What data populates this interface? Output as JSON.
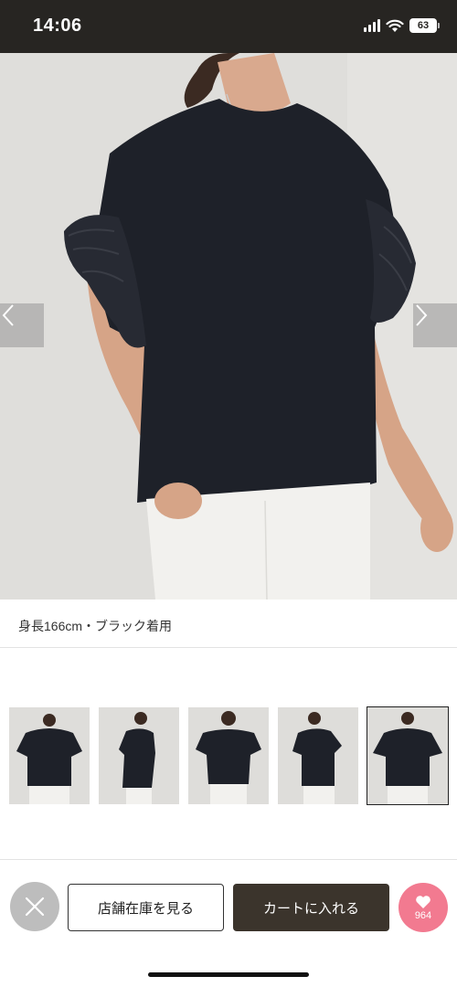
{
  "status_bar": {
    "time": "14:06",
    "battery": "63",
    "icons": [
      "signal-icon",
      "wifi-icon",
      "battery-icon"
    ]
  },
  "product": {
    "image_caption": "身長166cm・ブラック着用",
    "image_alt": "model wearing black ruffle-sleeve t-shirt",
    "thumbnail_count": 5,
    "selected_thumbnail": 5
  },
  "navigation": {
    "prev_icon": "chevron-left-icon",
    "next_icon": "chevron-right-icon"
  },
  "actions": {
    "close_icon": "close-icon",
    "store_stock_label": "店舗在庫を見る",
    "add_to_cart_label": "カートに入れる",
    "favorite_icon": "heart-icon",
    "favorite_count": "964"
  },
  "colors": {
    "status_bar_bg": "#272522",
    "cart_button_bg": "#3b342c",
    "favorite_bg": "#f27a90",
    "close_bg": "#bdbdbd"
  }
}
